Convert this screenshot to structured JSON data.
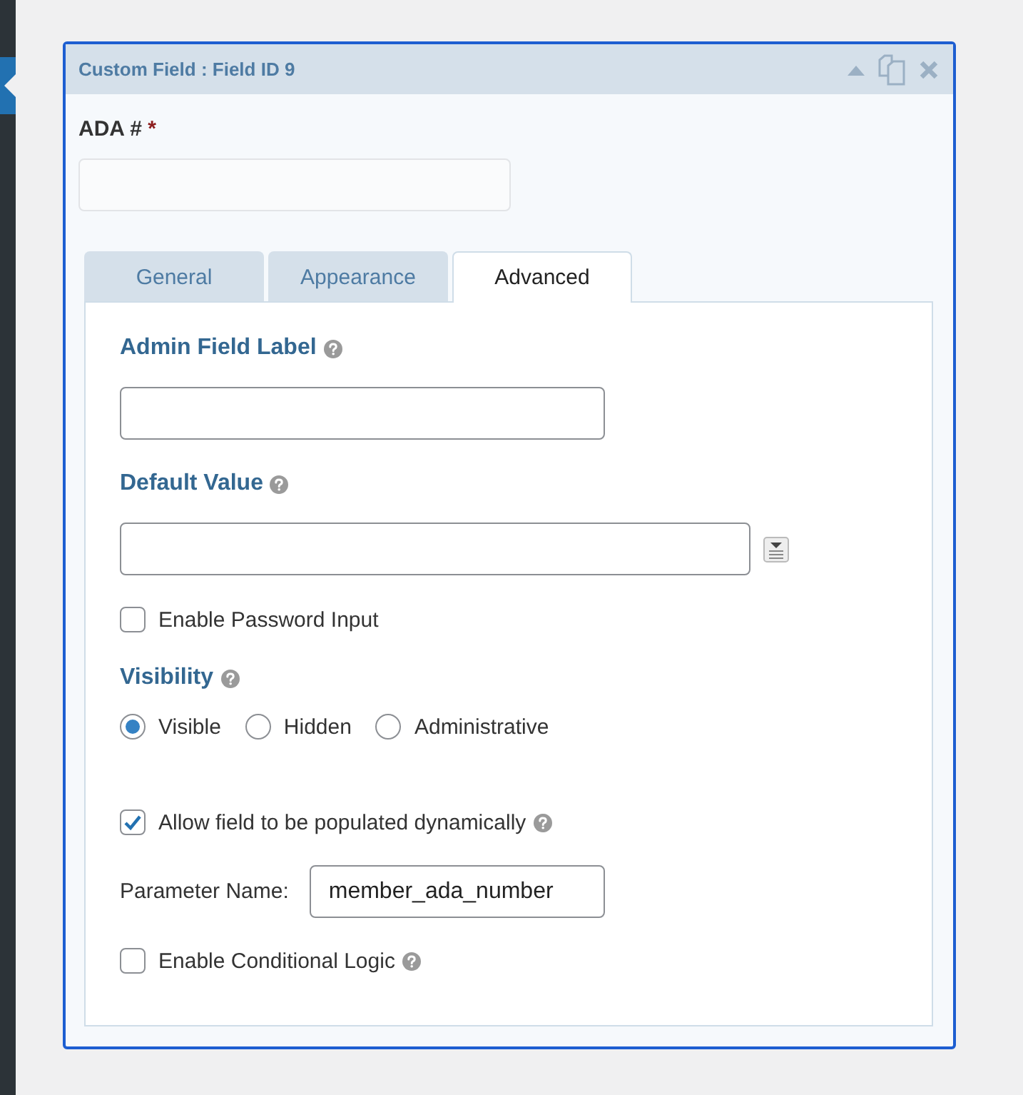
{
  "panel": {
    "title": "Custom Field : Field ID 9"
  },
  "field": {
    "label": "ADA #",
    "required_mark": "*"
  },
  "tabs": [
    {
      "label": "General",
      "selected": false
    },
    {
      "label": "Appearance",
      "selected": false
    },
    {
      "label": "Advanced",
      "selected": true
    }
  ],
  "admin_label": {
    "label": "Admin Field Label"
  },
  "default_value": {
    "label": "Default Value"
  },
  "password": {
    "label": "Enable Password Input",
    "checked": false
  },
  "visibility": {
    "label": "Visibility",
    "options": [
      {
        "label": "Visible",
        "selected": true
      },
      {
        "label": "Hidden",
        "selected": false
      },
      {
        "label": "Administrative",
        "selected": false
      }
    ]
  },
  "dynamic": {
    "label": "Allow field to be populated dynamically",
    "checked": true
  },
  "parameter": {
    "label": "Parameter Name:",
    "value": "member_ada_number"
  },
  "conditional": {
    "label": "Enable Conditional Logic",
    "checked": false
  }
}
